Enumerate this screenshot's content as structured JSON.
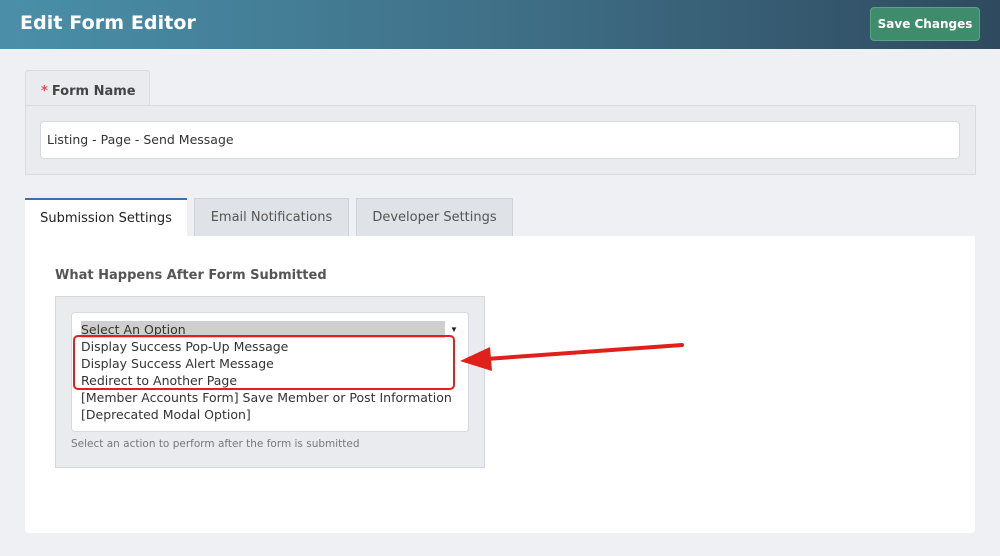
{
  "header": {
    "title": "Edit Form Editor",
    "save_label": "Save Changes"
  },
  "form_name": {
    "required_mark": "*",
    "label": "Form Name",
    "value": "Listing - Page - Send Message"
  },
  "tabs": [
    {
      "label": "Submission Settings",
      "active": true
    },
    {
      "label": "Email Notifications",
      "active": false
    },
    {
      "label": "Developer Settings",
      "active": false
    }
  ],
  "submission": {
    "label": "What Happens After Form Submitted",
    "options": [
      "Select An Option",
      "Display Success Pop-Up Message",
      "Display Success Alert Message",
      "Redirect to Another Page",
      "[Member Accounts Form] Save Member or Post Information",
      "[Deprecated Modal Option]"
    ],
    "help": "Select an action to perform after the form is submitted"
  },
  "colors": {
    "annotation": "#e0201b",
    "save_button": "#3f8c6d",
    "active_tab_border": "#3a6fb0"
  }
}
